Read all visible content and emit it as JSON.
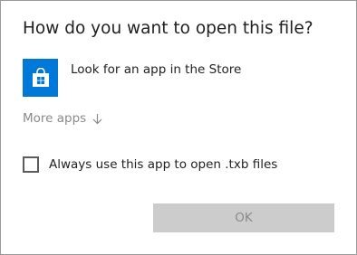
{
  "dialog": {
    "title": "How do you want to open this file?"
  },
  "store_option": {
    "icon": "store-icon",
    "label": "Look for an app in the Store",
    "tile_color": "#0078d7"
  },
  "more_apps": {
    "label": "More apps",
    "icon": "arrow-down-icon"
  },
  "always_use": {
    "label": "Always use this app to open .txb files",
    "checked": false
  },
  "ok_button": {
    "label": "OK",
    "enabled": false
  }
}
